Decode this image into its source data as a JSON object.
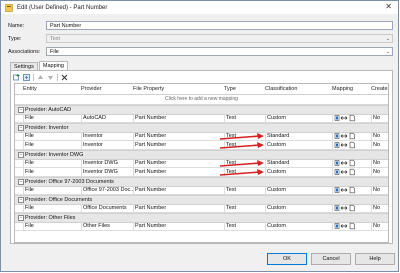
{
  "window": {
    "title": "Edit (User Defined) - Part Number"
  },
  "form": {
    "name_label": "Name:",
    "name_value": "Part Number",
    "type_label": "Type:",
    "type_value": "Text",
    "associations_label": "Associations:",
    "associations_value": "File"
  },
  "tabs": [
    {
      "label": "Settings",
      "active": false
    },
    {
      "label": "Mapping",
      "active": true
    }
  ],
  "grid": {
    "columns": [
      "Entity",
      "Provider",
      "File Property",
      "Type",
      "Classification",
      "Mapping",
      "Create"
    ],
    "add_row_hint": "Click here to add a new mapping",
    "groups": [
      {
        "title": "Provider: AutoCAD",
        "rows": [
          {
            "entity": "File",
            "provider": "AutoCAD",
            "property": "Part Number",
            "type": "Text",
            "classification": "Custom",
            "create": "No"
          }
        ]
      },
      {
        "title": "Provider: Inventor",
        "rows": [
          {
            "entity": "File",
            "provider": "Inventor",
            "property": "Part Number",
            "type": "Text",
            "classification": "Standard",
            "create": "No"
          },
          {
            "entity": "File",
            "provider": "Inventor",
            "property": "Part Number",
            "type": "Text",
            "classification": "Custom",
            "create": "No"
          }
        ]
      },
      {
        "title": "Provider: Inventor DWG",
        "rows": [
          {
            "entity": "File",
            "provider": "Inventor DWG",
            "property": "Part Number",
            "type": "Text",
            "classification": "Standard",
            "create": "No"
          },
          {
            "entity": "File",
            "provider": "Inventor DWG",
            "property": "Part Number",
            "type": "Text",
            "classification": "Custom",
            "create": "No"
          }
        ]
      },
      {
        "title": "Provider: Office 97-2003 Documents",
        "rows": [
          {
            "entity": "File",
            "provider": "Office 97-2003 Doc...",
            "property": "Part Number",
            "type": "Text",
            "classification": "Custom",
            "create": "No"
          }
        ]
      },
      {
        "title": "Provider: Office Documents",
        "rows": [
          {
            "entity": "File",
            "provider": "Office Documents",
            "property": "Part Number",
            "type": "Text",
            "classification": "Custom",
            "create": "No"
          }
        ]
      },
      {
        "title": "Provider: Other Files",
        "rows": [
          {
            "entity": "File",
            "provider": "Other Files",
            "property": "Part Number",
            "type": "Text",
            "classification": "Custom",
            "create": "No"
          }
        ]
      }
    ]
  },
  "buttons": {
    "ok": "OK",
    "cancel": "Cancel",
    "help": "Help"
  },
  "colors": {
    "accent": "#0078d7",
    "annotation_arrow": "#d42020"
  },
  "icons": [
    "app-icon",
    "close-icon",
    "add-mapping-icon",
    "import-icon",
    "move-up-icon",
    "move-down-icon",
    "delete-icon",
    "bidirectional-mapping-icon",
    "document-icon"
  ]
}
